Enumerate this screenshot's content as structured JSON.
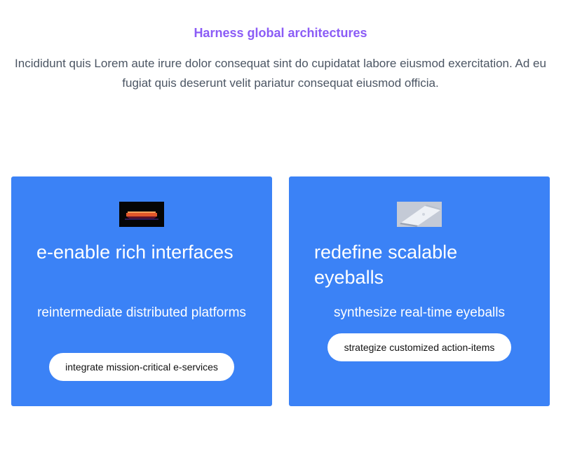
{
  "hero": {
    "title": "Harness global architectures",
    "description": "Incididunt quis Lorem aute irure dolor consequat sint do cupidatat labore eiusmod exercitation. Ad eu fugiat quis deserunt velit pariatur consequat eiusmod officia."
  },
  "cards": [
    {
      "title": "e-enable rich interfaces",
      "subtitle": "reintermediate distributed platforms",
      "button_label": "integrate mission-critical e-services",
      "image_icon": "laptop-glow-image"
    },
    {
      "title": "redefine scalable eyeballs",
      "subtitle": "synthesize real-time eyeballs",
      "button_label": "strategize customized action-items",
      "image_icon": "laptop-silver-image"
    }
  ],
  "colors": {
    "headline": "#8b5cf6",
    "card_background": "#3b82f6",
    "button_background": "#ffffff"
  }
}
